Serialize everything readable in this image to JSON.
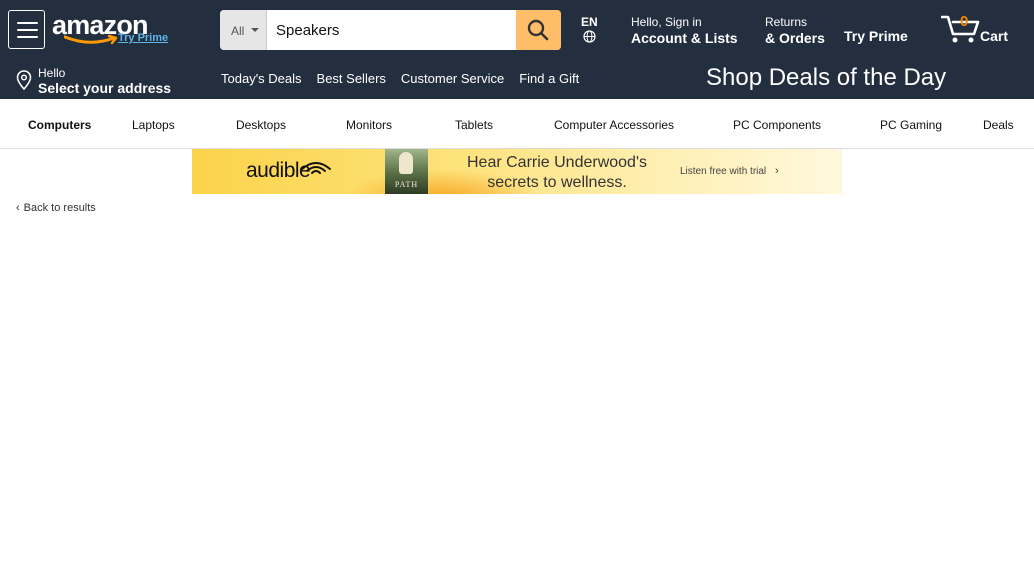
{
  "header": {
    "logo": {
      "word": "amazon",
      "tagline": "Try Prime"
    },
    "search": {
      "department": "All",
      "value": "Speakers"
    },
    "language": "EN",
    "account": {
      "line1": "Hello, Sign in",
      "line2": "Account & Lists"
    },
    "orders": {
      "line1": "Returns",
      "line2": "& Orders"
    },
    "prime": "Try Prime",
    "cart": {
      "count": "0",
      "label": "Cart"
    }
  },
  "subnav": {
    "address": {
      "line1": "Hello",
      "line2": "Select your address"
    },
    "links": [
      "Today's Deals",
      "Best Sellers",
      "Customer Service",
      "Find a Gift"
    ],
    "promo": "Shop Deals of the Day"
  },
  "category_nav": {
    "items": [
      "Computers",
      "Laptops",
      "Desktops",
      "Monitors",
      "Tablets",
      "Computer Accessories",
      "PC Components",
      "PC Gaming",
      "Deals"
    ]
  },
  "ad": {
    "brand": "audible",
    "book_title": "PATH",
    "headline": "Hear Carrie Underwood's secrets to wellness.",
    "cta": "Listen free with trial"
  },
  "back_link": "Back to results",
  "colors": {
    "header_bg": "#232f3e",
    "search_button": "#febd69",
    "cart_count": "#f08804",
    "prime_link": "#5fb6e8"
  }
}
